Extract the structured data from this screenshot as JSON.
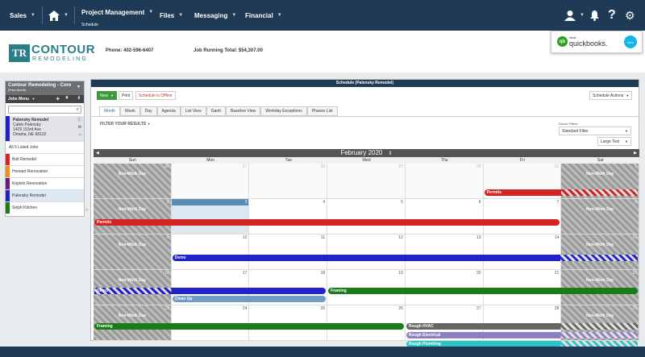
{
  "nav": {
    "sales": "Sales",
    "home_icon": "home-icon",
    "project_management": "Project Management",
    "project_sub": "Schedule",
    "files": "Files",
    "messaging": "Messaging",
    "financial": "Financial"
  },
  "header": {
    "logo_letters": "TR",
    "logo_name": "CONTOUR",
    "logo_sub": "REMODELING",
    "phone": "Phone: 402-596-6407",
    "running_total": "Job Running Total:  $54,307.00",
    "qb_brand": "intuit",
    "qb_name": "quickbooks.",
    "xero": "xero"
  },
  "left": {
    "company": "Contour Remodeling - Core",
    "user": "(Paul Worth)",
    "menu": "Jobs Menu",
    "selected": {
      "name": "Palensky Remodel",
      "client": "Caleb Palensky",
      "address1": "1429 153rd Ave",
      "address2": "Omaha, NE 68102"
    },
    "all_jobs": "All 5 Listed Jobs",
    "jobs": [
      {
        "name": "Bolt Remodel",
        "color": "#d42323"
      },
      {
        "name": "Horwart Renovation",
        "color": "#f28c1c"
      },
      {
        "name": "Kopietz Renovation",
        "color": "#6b1c7a"
      },
      {
        "name": "Palensky Remodel",
        "color": "#2222cc"
      },
      {
        "name": "Selph Kitchen",
        "color": "#187d18"
      }
    ]
  },
  "schedule": {
    "title": "Schedule (Palensky Remodel)",
    "new_btn": "New",
    "print_btn": "Print",
    "offline_btn": "Schedule is Offline",
    "actions_btn": "Schedule Actions",
    "views": [
      "Month",
      "Week",
      "Day",
      "Agenda",
      "List View",
      "Gantt",
      "Baseline View",
      "Workday Exceptions",
      "Phases List"
    ],
    "filter": "FILTER YOUR RESULTS",
    "saved_filters_label": "Saved Filters",
    "standard_filter": "Standard Filter",
    "text_size": "Large Text",
    "month": "February 2020",
    "days": [
      "Sun",
      "Mon",
      "Tue",
      "Wed",
      "Thu",
      "Fri",
      "Sat"
    ],
    "nonwork": "Non-Work Day",
    "weeks": [
      [
        "26",
        "27",
        "28",
        "29",
        "30",
        "31",
        "1"
      ],
      [
        "2",
        "3",
        "4",
        "5",
        "6",
        "7",
        "8"
      ],
      [
        "9",
        "10",
        "11",
        "12",
        "13",
        "14",
        "15"
      ],
      [
        "16",
        "17",
        "18",
        "19",
        "20",
        "21",
        "22"
      ],
      [
        "23",
        "24",
        "25",
        "26",
        "27",
        "28",
        "29"
      ]
    ],
    "events": {
      "permits1": "Permits",
      "permits2": "Permits",
      "demo1": "Demo",
      "demo2": "Demo",
      "clean_up": "Clean Up",
      "framing1": "Framing",
      "framing2": "Framing",
      "rough_hvac": "Rough HVAC",
      "rough_electrical": "Rough Electrical",
      "rough_plumbing": "Rough Plumbing"
    }
  }
}
